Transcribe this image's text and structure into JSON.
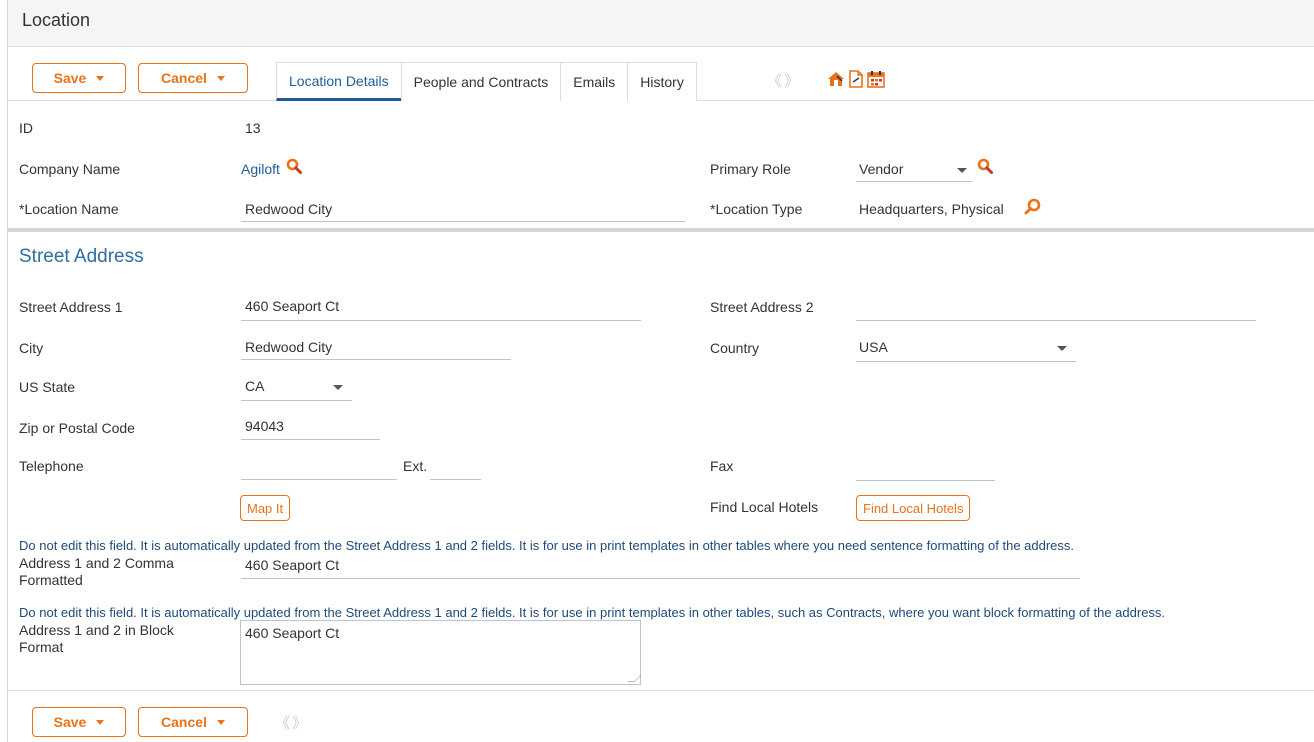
{
  "window": {
    "title": "Location"
  },
  "toolbar": {
    "save_label": "Save",
    "cancel_label": "Cancel",
    "nav_arrows": "《 》"
  },
  "tabs": [
    {
      "label": "Location Details",
      "active": true
    },
    {
      "label": "People and Contracts",
      "active": false
    },
    {
      "label": "Emails",
      "active": false
    },
    {
      "label": "History",
      "active": false
    }
  ],
  "toolbar_icons": [
    "home-edit-icon",
    "document-icon",
    "calendar-icon"
  ],
  "details": {
    "id_label": "ID",
    "id_value": "13",
    "company_label": "Company Name",
    "company_value": "Agiloft",
    "primary_role_label": "Primary Role",
    "primary_role_value": "Vendor",
    "location_name_label": "*Location Name",
    "location_name_value": "Redwood City",
    "location_type_label": "*Location Type",
    "location_type_value": "Headquarters, Physical"
  },
  "address": {
    "section_title": "Street Address",
    "street1_label": "Street Address 1",
    "street1_value": "460 Seaport Ct",
    "street2_label": "Street Address 2",
    "street2_value": "",
    "city_label": "City",
    "city_value": "Redwood City",
    "country_label": "Country",
    "country_value": "USA",
    "state_label": "US State",
    "state_value": "CA",
    "zip_label": "Zip or Postal Code",
    "zip_value": "94043",
    "telephone_label": "Telephone",
    "telephone_value": "",
    "ext_label": "Ext.",
    "ext_value": "",
    "fax_label": "Fax",
    "fax_value": "",
    "map_button": "Map It",
    "hotels_label": "Find Local Hotels",
    "hotels_button": "Find Local Hotels",
    "note_comma": "Do not edit this field. It is automatically updated from the Street Address 1 and 2 fields. It is for use in print templates in other tables where you need sentence formatting of the address.",
    "comma_label_1": "Address 1 and 2 Comma",
    "comma_label_2": "Formatted",
    "comma_value": "460 Seaport Ct",
    "note_block": "Do not edit this field. It is automatically updated from the Street Address 1 and 2 fields. It is for use in print templates in other tables, such as Contracts, where you want block formatting of the address.",
    "block_label_1": "Address 1 and 2 in Block",
    "block_label_2": "Format",
    "block_value": "460 Seaport Ct"
  },
  "colors": {
    "accent": "#e8731a",
    "tab_active": "#1e5c99",
    "section_title": "#2f6da3",
    "search_icon": "#e8731a"
  }
}
